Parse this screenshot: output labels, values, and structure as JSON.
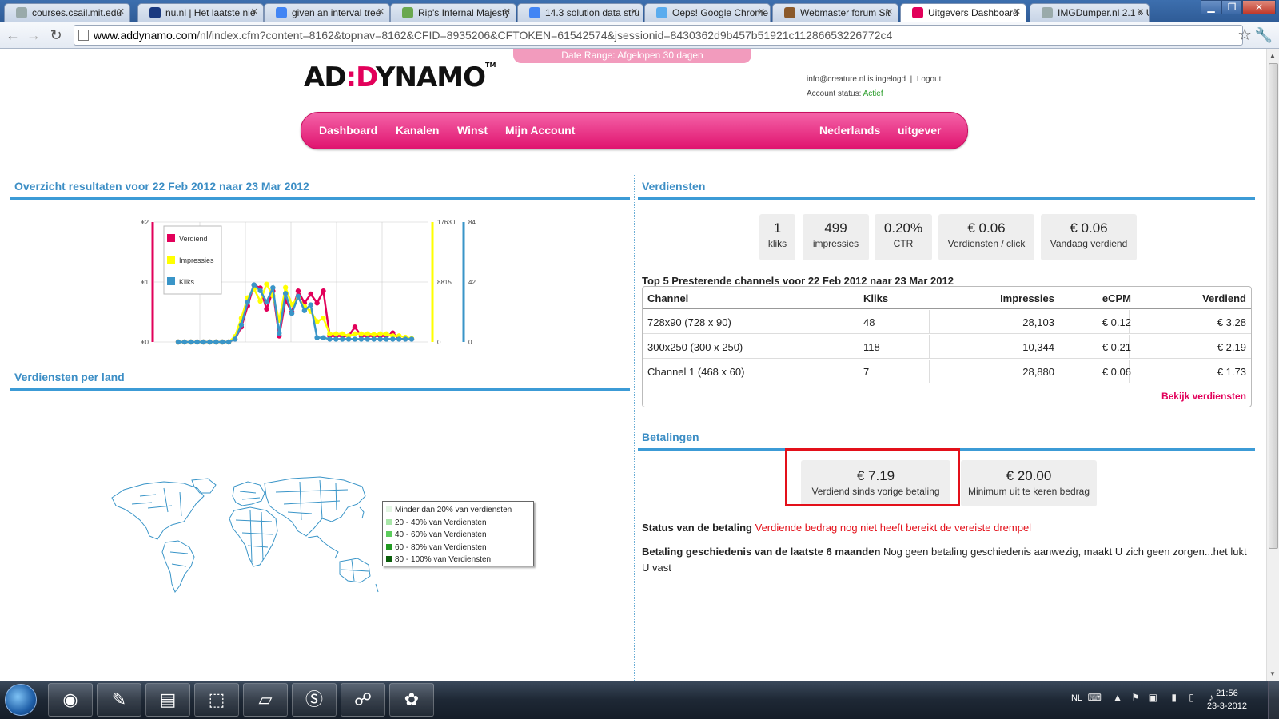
{
  "browser": {
    "tabs": [
      {
        "title": "courses.csail.mit.edu",
        "fav": "#9aa"
      },
      {
        "title": "nu.nl | Het laatste nie",
        "fav": "#1b3a80"
      },
      {
        "title": "given an interval tree",
        "fav": "#4285f4"
      },
      {
        "title": "Rip's Infernal Majesty",
        "fav": "#6aa84f"
      },
      {
        "title": "14.3 solution data stru",
        "fav": "#4285f4"
      },
      {
        "title": "Oeps! Google Chrome",
        "fav": "#5aacee"
      },
      {
        "title": "Webmaster forum Sit",
        "fav": "#8b5a2b"
      },
      {
        "title": "Uitgevers Dashboard",
        "fav": "#e2005a"
      },
      {
        "title": "IMGDumper.nl 2.1 » U",
        "fav": "#9aa"
      }
    ],
    "url_host": "www.addynamo.com",
    "url_path": "/nl/index.cfm?content=8162&topnav=8162&CFID=8935206&CFTOKEN=61542574&jsessionid=8430362d9b457b51921c11286653226772c4"
  },
  "header": {
    "date_range": "Date Range: Afgelopen 30 dagen",
    "logo_left": "AD",
    "logo_mid": ":D",
    "logo_right": "YNAMO",
    "logo_tm": "TM",
    "login_text": "info@creature.nl is ingelogd",
    "logout": "Logout",
    "status_label": "Account status:",
    "status_value": "Actief"
  },
  "nav": {
    "dashboard": "Dashboard",
    "kanalen": "Kanalen",
    "winst": "Winst",
    "account": "Mijn Account",
    "language": "Nederlands",
    "role": "uitgever"
  },
  "overview": {
    "title": "Overzicht resultaten voor 22 Feb 2012 naar 23 Mar 2012"
  },
  "chart_data": {
    "type": "line",
    "title": "",
    "legend": [
      "Verdiend",
      "Impressies",
      "Kliks"
    ],
    "legend_position": "top-left",
    "colors": {
      "Verdiend": "#e2005a",
      "Impressies": "#ffff00",
      "Kliks": "#3a95c8"
    },
    "y_left_ticks": [
      "€2",
      "€1",
      "€0"
    ],
    "y_impr_ticks": [
      "17630",
      "8815",
      "0"
    ],
    "y_kliks_ticks": [
      "84",
      "42",
      "0"
    ],
    "y_left_range": [
      0,
      2
    ],
    "y_impr_range": [
      0,
      17630
    ],
    "y_kliks_range": [
      0,
      84
    ],
    "grid": true,
    "series": [
      {
        "name": "Verdiend",
        "values": [
          0,
          0,
          0,
          0,
          0,
          0,
          0,
          0,
          0,
          0.05,
          0.25,
          0.6,
          0.95,
          0.9,
          0.55,
          0.85,
          0.1,
          0.7,
          0.5,
          0.85,
          0.65,
          0.8,
          0.65,
          0.85,
          0.1,
          0.1,
          0.1,
          0.1,
          0.25,
          0.1,
          0.1,
          0.1,
          0.1,
          0.1,
          0.15,
          0.05,
          0.05,
          0.05
        ]
      },
      {
        "name": "Impressies",
        "values": [
          0,
          0,
          0,
          0,
          0,
          0,
          0,
          0,
          0,
          800,
          3500,
          6500,
          7800,
          6000,
          8500,
          6800,
          3200,
          8000,
          5500,
          6500,
          5200,
          4500,
          3000,
          3500,
          1200,
          1200,
          1200,
          900,
          1200,
          1200,
          1200,
          1100,
          1200,
          1200,
          900,
          900,
          700,
          500
        ]
      },
      {
        "name": "Kliks",
        "values": [
          0,
          0,
          0,
          0,
          0,
          0,
          0,
          0,
          0,
          2,
          12,
          28,
          40,
          36,
          28,
          38,
          6,
          34,
          20,
          32,
          22,
          26,
          3,
          3,
          2,
          2,
          2,
          2,
          2,
          2,
          2,
          2,
          2,
          2,
          2,
          2,
          2,
          2
        ]
      }
    ]
  },
  "country": {
    "title": "Verdiensten per land",
    "legend": [
      {
        "label": "Minder dan 20% van verdiensten",
        "color": "#e4f6e4"
      },
      {
        "label": "20 - 40% van Verdiensten",
        "color": "#a8e6a8"
      },
      {
        "label": "40 - 60% van Verdiensten",
        "color": "#5ccc5c"
      },
      {
        "label": "60 - 80% van Verdiensten",
        "color": "#229922"
      },
      {
        "label": "80 - 100% van Verdiensten",
        "color": "#0b5e0b"
      }
    ]
  },
  "earnings": {
    "title": "Verdiensten",
    "stats": [
      {
        "value": "1",
        "label": "kliks"
      },
      {
        "value": "499",
        "label": "impressies"
      },
      {
        "value": "0.20%",
        "label": "CTR"
      },
      {
        "value": "€ 0.06",
        "label": "Verdiensten / click"
      },
      {
        "value": "€ 0.06",
        "label": "Vandaag verdiend"
      }
    ],
    "top5_title": "Top 5 Presterende channels voor 22 Feb 2012 naar 23 Mar 2012",
    "columns": [
      "Channel",
      "Kliks",
      "Impressies",
      "eCPM",
      "Verdiend"
    ],
    "rows": [
      [
        "728x90 (728 x 90)",
        "48",
        "28,103",
        "€ 0.12",
        "€ 3.28"
      ],
      [
        "300x250 (300 x 250)",
        "118",
        "10,344",
        "€ 0.21",
        "€ 2.19"
      ],
      [
        "Channel 1 (468 x 60)",
        "7",
        "28,880",
        "€ 0.06",
        "€ 1.73"
      ]
    ],
    "more_link": "Bekijk verdiensten"
  },
  "payments": {
    "title": "Betalingen",
    "earned_value": "€ 7.19",
    "earned_label": "Verdiend sinds vorige betaling",
    "min_value": "€ 20.00",
    "min_label": "Minimum uit te keren bedrag",
    "status_label": "Status van de betaling",
    "status_value": "Verdiende bedrag nog niet heeft bereikt de vereiste drempel",
    "history_label": "Betaling geschiedenis van de laatste 6 maanden",
    "history_value": "Nog geen betaling geschiedenis aanwezig, maakt U zich geen zorgen...het lukt U vast"
  },
  "taskbar": {
    "lang": "NL",
    "time": "21:56",
    "date": "23-3-2012"
  }
}
